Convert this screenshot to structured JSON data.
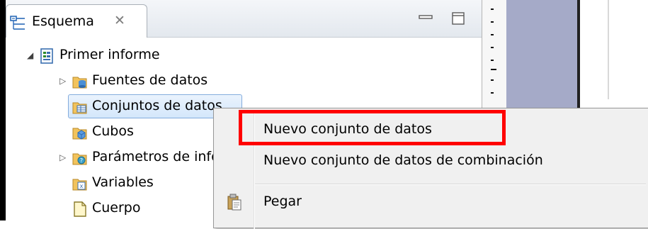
{
  "outline_view": {
    "tab_title": "Esquema",
    "close_glyph": "✕",
    "tab_icon": "outline-icon",
    "controls": [
      "minimize-icon",
      "maximize-icon"
    ]
  },
  "tree": {
    "root": {
      "label": "Primer informe",
      "icon": "report-icon",
      "expanded": true
    },
    "children": [
      {
        "label": "Fuentes de datos",
        "icon": "data-sources-icon",
        "expandable": true
      },
      {
        "label": "Conjuntos de datos",
        "icon": "data-sets-icon",
        "expandable": false,
        "selected": true
      },
      {
        "label": "Cubos",
        "icon": "cubes-icon",
        "expandable": false
      },
      {
        "label": "Parámetros de informe",
        "icon": "parameters-icon",
        "expandable": true
      },
      {
        "label": "Variables",
        "icon": "variables-icon",
        "expandable": false
      },
      {
        "label": "Cuerpo",
        "icon": "body-icon",
        "expandable": false
      }
    ]
  },
  "context_menu": {
    "items": [
      {
        "label": "Nuevo conjunto de datos",
        "highlighted": true
      },
      {
        "label": "Nuevo conjunto de datos de combinación"
      },
      {
        "label": "Pegar",
        "icon": "paste-icon"
      }
    ]
  },
  "colors": {
    "highlight": "#ff0000",
    "selection": "#d4e7fb",
    "editor_background": "#a5aac8"
  }
}
